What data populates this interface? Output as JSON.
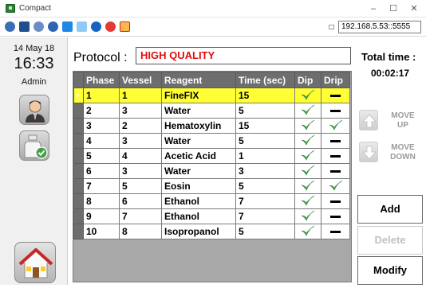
{
  "window": {
    "title": "Compact",
    "minimize": "–",
    "maximize": "☐",
    "close": "✕"
  },
  "toolbar": {
    "address": "192.168.5.53::5555"
  },
  "sidebar": {
    "date": "14 May 18",
    "time": "16:33",
    "user": "Admin"
  },
  "protocol": {
    "label": "Protocol :",
    "name": "HIGH QUALITY"
  },
  "total_time": {
    "label": "Total time :",
    "value": "00:02:17"
  },
  "table": {
    "columns": [
      "Phase",
      "Vessel",
      "Reagent",
      "Time (sec)",
      "Dip",
      "Drip"
    ],
    "selected_row": 0,
    "rows": [
      {
        "phase": "1",
        "vessel": "1",
        "reagent": "FineFIX",
        "time": "15",
        "dip": true,
        "drip": false
      },
      {
        "phase": "2",
        "vessel": "3",
        "reagent": "Water",
        "time": "5",
        "dip": true,
        "drip": false
      },
      {
        "phase": "3",
        "vessel": "2",
        "reagent": "Hematoxylin",
        "time": "15",
        "dip": true,
        "drip": true
      },
      {
        "phase": "4",
        "vessel": "3",
        "reagent": "Water",
        "time": "5",
        "dip": true,
        "drip": false
      },
      {
        "phase": "5",
        "vessel": "4",
        "reagent": "Acetic Acid",
        "time": "1",
        "dip": true,
        "drip": false
      },
      {
        "phase": "6",
        "vessel": "3",
        "reagent": "Water",
        "time": "3",
        "dip": true,
        "drip": false
      },
      {
        "phase": "7",
        "vessel": "5",
        "reagent": "Eosin",
        "time": "5",
        "dip": true,
        "drip": true
      },
      {
        "phase": "8",
        "vessel": "6",
        "reagent": "Ethanol",
        "time": "7",
        "dip": true,
        "drip": false
      },
      {
        "phase": "9",
        "vessel": "7",
        "reagent": "Ethanol",
        "time": "7",
        "dip": true,
        "drip": false
      },
      {
        "phase": "10",
        "vessel": "8",
        "reagent": "Isopropanol",
        "time": "5",
        "dip": true,
        "drip": false
      }
    ]
  },
  "buttons": {
    "move_up": [
      "MOVE",
      "UP"
    ],
    "move_down": [
      "MOVE",
      "DOWN"
    ],
    "add": "Add",
    "delete": "Delete",
    "modify": "Modify"
  },
  "colors": {
    "selected_row": "#ffff33",
    "protocol_name": "#e01010",
    "check": "#4caf50",
    "header": "#6e6e6e"
  }
}
